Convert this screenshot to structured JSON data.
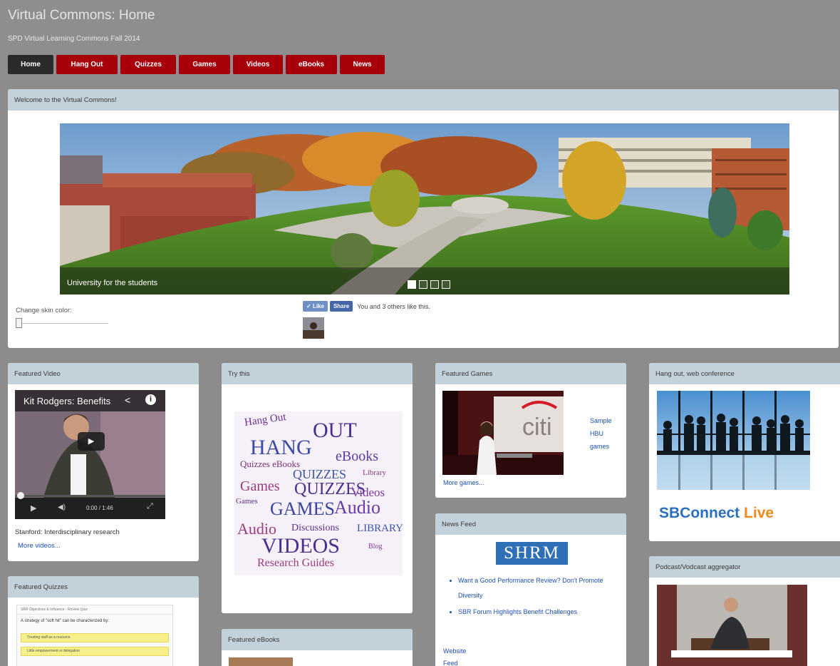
{
  "site": {
    "title": "Virtual Commons: Home",
    "subtitle": "SPD Virtual Learning Commons Fall 2014"
  },
  "nav": [
    {
      "label": "Home",
      "active": true
    },
    {
      "label": "Hang Out",
      "active": false
    },
    {
      "label": "Quizzes",
      "active": false
    },
    {
      "label": "Games",
      "active": false
    },
    {
      "label": "Videos",
      "active": false
    },
    {
      "label": "eBooks",
      "active": false
    },
    {
      "label": "News",
      "active": false
    }
  ],
  "welcome": {
    "header": "Welcome to the Virtual Commons!",
    "banner_caption": "University for the students",
    "slide_count": 4,
    "active_slide": 1,
    "banner_credit": "",
    "skin_label": "Change skin color:",
    "like_label": "Like",
    "share_label": "Share",
    "like_text": "You and 3 others like this."
  },
  "featured_video": {
    "header": "Featured Video",
    "video_title": "Kit Rodgers: Benefits",
    "time": "0:00 / 1:46",
    "caption": "Stanford: Interdisciplinary research",
    "more_link": "More videos..."
  },
  "try_this": {
    "header": "Try this"
  },
  "featured_games": {
    "header": "Featured Games",
    "sample_link": "Sample HBU games",
    "more_link": "More games...",
    "screen_text": "citi"
  },
  "news_feed": {
    "header": "News Feed",
    "logo_text": "SHRM",
    "items": [
      "Want a Good Performance Review? Don't Promote Diversity",
      "SBR Forum Highlights Benefit Challenges"
    ],
    "website_link": "Website",
    "feed_link": "Feed"
  },
  "hang_out": {
    "header": "Hang out, web conference",
    "brand_sb": "SBConnect",
    "brand_live": "Live"
  },
  "podcast": {
    "header": "Podcast/Vodcast aggregator"
  },
  "featured_quizzes": {
    "header": "Featured Quizzes",
    "quiz_title": "SBR Objectives & Influence - Review Quiz",
    "quiz_question": "A strategy of \"soft hit\" can be characterized by:",
    "options": [
      "Treating staff as a resource",
      "Little empowerment or delegation"
    ]
  },
  "featured_ebooks": {
    "header": "Featured eBooks"
  },
  "colors": {
    "nav_red": "#a8000b",
    "nav_active": "#2a2a2a",
    "panel_header": "#c3d1da",
    "link_blue": "#1d4fb3",
    "sb_blue": "#2a6fc0",
    "live_orange": "#f08a1e"
  }
}
